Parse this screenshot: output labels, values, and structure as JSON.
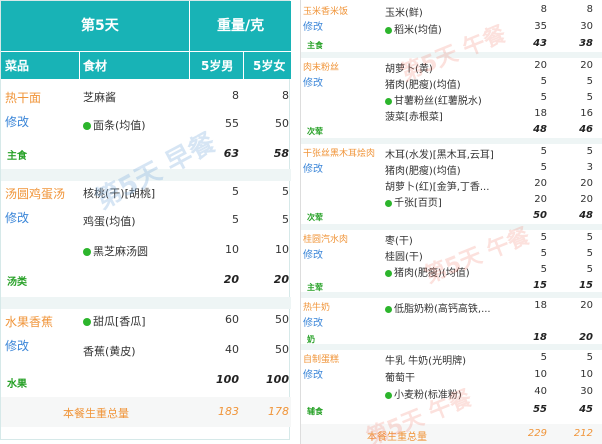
{
  "left": {
    "header": {
      "day": "第5天",
      "unit": "重量/克",
      "col_dish": "菜品",
      "col_food": "食材",
      "col_male": "5岁男",
      "col_female": "5岁女"
    },
    "sections": [
      {
        "dish": "热干面",
        "edit": "修改",
        "category": "主食",
        "rows": [
          {
            "food": "芝麻酱",
            "dot": false,
            "male": "8",
            "female": "8"
          },
          {
            "food": "面条(均值)",
            "dot": true,
            "male": "55",
            "female": "50"
          }
        ],
        "total_male": "63",
        "total_female": "58"
      },
      {
        "dish": "汤圆鸡蛋汤",
        "edit": "修改",
        "category": "汤类",
        "rows": [
          {
            "food": "核桃(干)[胡桃]",
            "dot": false,
            "male": "5",
            "female": "5"
          },
          {
            "food": "鸡蛋(均值)",
            "dot": false,
            "male": "5",
            "female": "5"
          },
          {
            "food": "黑芝麻汤圆",
            "dot": true,
            "male": "10",
            "female": "10"
          }
        ],
        "total_male": "20",
        "total_female": "20"
      },
      {
        "dish": "水果香蕉",
        "edit": "修改",
        "category": "水果",
        "rows": [
          {
            "food": "甜瓜[香瓜]",
            "dot": true,
            "male": "60",
            "female": "50"
          },
          {
            "food": "香蕉(黄皮)",
            "dot": false,
            "male": "40",
            "female": "50"
          }
        ],
        "total_male": "100",
        "total_female": "100"
      }
    ],
    "summary": {
      "label": "本餐生重总量",
      "male": "183",
      "female": "178"
    },
    "watermark": "第5天 早餐"
  },
  "right": {
    "sections": [
      {
        "dish": "玉米香米饭",
        "edit": "修改",
        "category": "主食",
        "rows": [
          {
            "food": "玉米(鲜)",
            "dot": false,
            "male": "8",
            "female": "8"
          },
          {
            "food": "稻米(均值)",
            "dot": true,
            "male": "35",
            "female": "30"
          }
        ],
        "total_male": "43",
        "total_female": "38"
      },
      {
        "dish": "肉末粉丝",
        "edit": "修改",
        "category": "次荤",
        "rows": [
          {
            "food": "胡萝卜(黄)",
            "dot": false,
            "male": "20",
            "female": "20"
          },
          {
            "food": "猪肉(肥瘦)(均值)",
            "dot": false,
            "male": "5",
            "female": "5"
          },
          {
            "food": "甘薯粉丝(红薯脱水)",
            "dot": true,
            "male": "5",
            "female": "5"
          },
          {
            "food": "菠菜[赤根菜]",
            "dot": false,
            "male": "18",
            "female": "16"
          }
        ],
        "total_male": "48",
        "total_female": "46"
      },
      {
        "dish": "干张丝黑木耳烩肉",
        "edit": "修改",
        "category": "次荤",
        "rows": [
          {
            "food": "木耳(水发)[黑木耳,云耳]",
            "dot": false,
            "male": "5",
            "female": "5"
          },
          {
            "food": "猪肉(肥瘦)(均值)",
            "dot": false,
            "male": "5",
            "female": "3"
          },
          {
            "food": "胡萝卜(红)[金笋,丁香...",
            "dot": false,
            "male": "20",
            "female": "20"
          },
          {
            "food": "千张[百页]",
            "dot": true,
            "male": "20",
            "female": "20"
          }
        ],
        "total_male": "50",
        "total_female": "48"
      },
      {
        "dish": "桂圆汽水肉",
        "edit": "修改",
        "category": "主荤",
        "rows": [
          {
            "food": "枣(干)",
            "dot": false,
            "male": "5",
            "female": "5"
          },
          {
            "food": "桂圆(干)",
            "dot": false,
            "male": "5",
            "female": "5"
          },
          {
            "food": "猪肉(肥瘦)(均值)",
            "dot": true,
            "male": "5",
            "female": "5"
          }
        ],
        "total_male": "15",
        "total_female": "15"
      },
      {
        "dish": "热牛奶",
        "edit": "修改",
        "category": "奶",
        "rows": [
          {
            "food": "低脂奶粉(高钙高铁,...",
            "dot": true,
            "male": "18",
            "female": "20"
          }
        ],
        "total_male": "18",
        "total_female": "20"
      },
      {
        "dish": "自制蛋糕",
        "edit": "修改",
        "category": "辅食",
        "rows": [
          {
            "food": "牛乳 牛奶(光明牌)",
            "dot": false,
            "male": "5",
            "female": "5"
          },
          {
            "food": "葡萄干",
            "dot": false,
            "male": "10",
            "female": "10"
          },
          {
            "food": "小麦粉(标准粉)",
            "dot": true,
            "male": "40",
            "female": "30"
          }
        ],
        "total_male": "55",
        "total_female": "45"
      }
    ],
    "summary": {
      "label": "本餐生重总量",
      "male": "229",
      "female": "212"
    },
    "watermark": "第5天 午餐"
  }
}
